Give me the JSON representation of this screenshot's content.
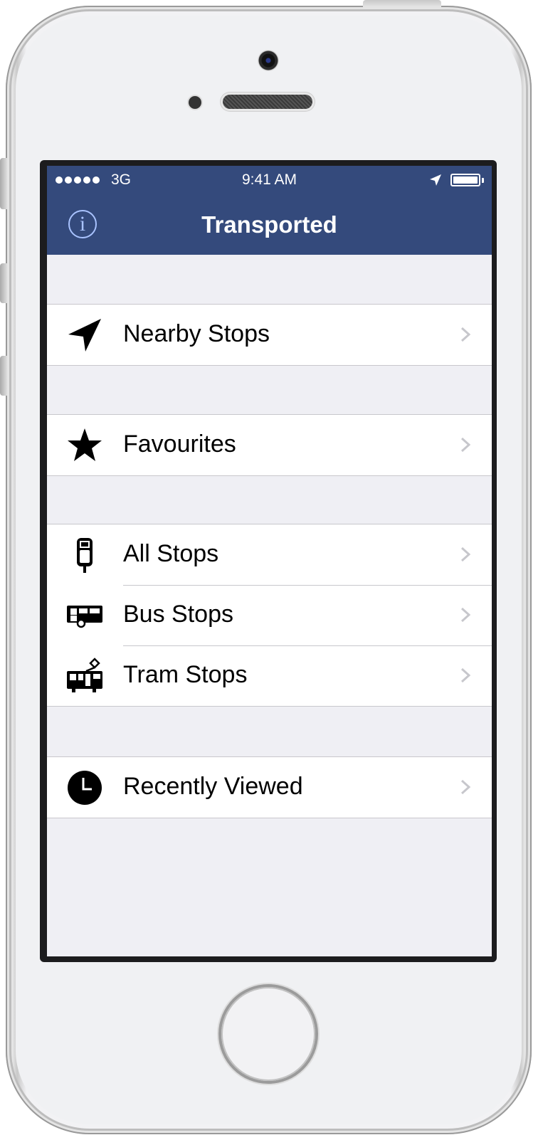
{
  "status_bar": {
    "carrier": "3G",
    "time": "9:41 AM",
    "battery_level": 1.0
  },
  "nav": {
    "title": "Transported",
    "info_icon": "info-icon",
    "info_glyph": "i"
  },
  "sections": [
    {
      "rows": [
        {
          "label": "Nearby Stops",
          "icon": "location-arrow-icon"
        }
      ]
    },
    {
      "rows": [
        {
          "label": "Favourites",
          "icon": "star-icon"
        }
      ]
    },
    {
      "rows": [
        {
          "label": "All Stops",
          "icon": "stop-sign-icon"
        },
        {
          "label": "Bus Stops",
          "icon": "bus-icon"
        },
        {
          "label": "Tram Stops",
          "icon": "tram-icon"
        }
      ]
    },
    {
      "rows": [
        {
          "label": "Recently Viewed",
          "icon": "clock-icon"
        }
      ]
    }
  ],
  "colors": {
    "nav_background": "#344a7c",
    "info_icon": "#a9c3ff",
    "table_background": "#efeff4",
    "separator": "#c8c7cc",
    "chevron": "#c7c7cc"
  }
}
